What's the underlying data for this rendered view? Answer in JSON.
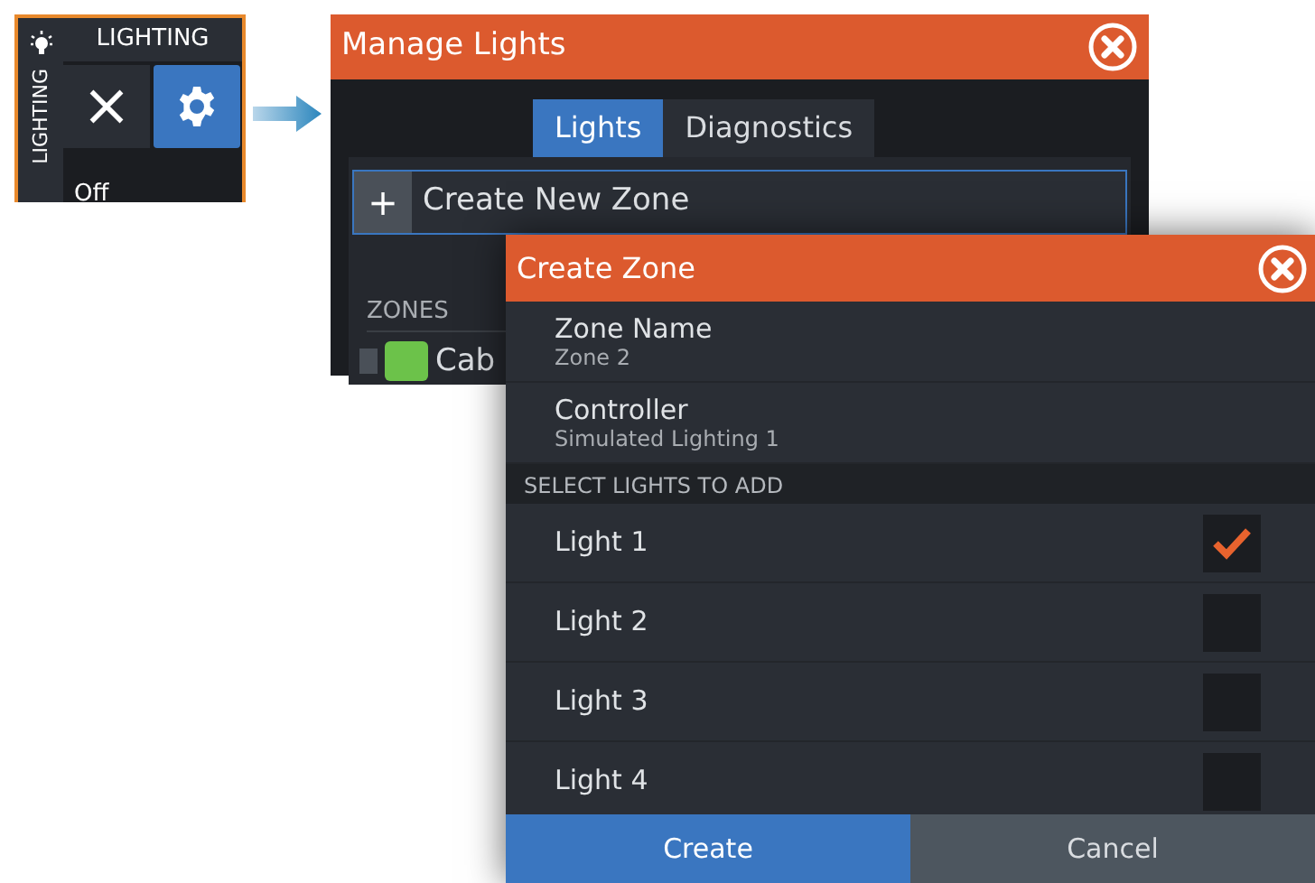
{
  "lighting_panel": {
    "side_label": "LIGHTING",
    "title": "LIGHTING",
    "status": "Off",
    "settings_selected": true
  },
  "manage_lights": {
    "title": "Manage Lights",
    "tabs": [
      {
        "label": "Lights",
        "selected": true
      },
      {
        "label": "Diagnostics",
        "selected": false
      }
    ],
    "create_button": {
      "icon": "+",
      "label": "Create New Zone"
    },
    "zones_header": "ZONES",
    "zones": [
      {
        "name": "Cab",
        "color": "#6cc24a"
      }
    ]
  },
  "create_zone": {
    "title": "Create Zone",
    "fields": [
      {
        "label": "Zone Name",
        "value": "Zone 2"
      },
      {
        "label": "Controller",
        "value": "Simulated Lighting 1"
      }
    ],
    "section_header": "SELECT LIGHTS TO ADD",
    "lights": [
      {
        "name": "Light 1",
        "checked": true
      },
      {
        "name": "Light 2",
        "checked": false
      },
      {
        "name": "Light 3",
        "checked": false
      },
      {
        "name": "Light 4",
        "checked": false
      }
    ],
    "buttons": [
      {
        "label": "Create",
        "kind": "primary"
      },
      {
        "label": "Cancel",
        "kind": "secondary"
      }
    ]
  }
}
